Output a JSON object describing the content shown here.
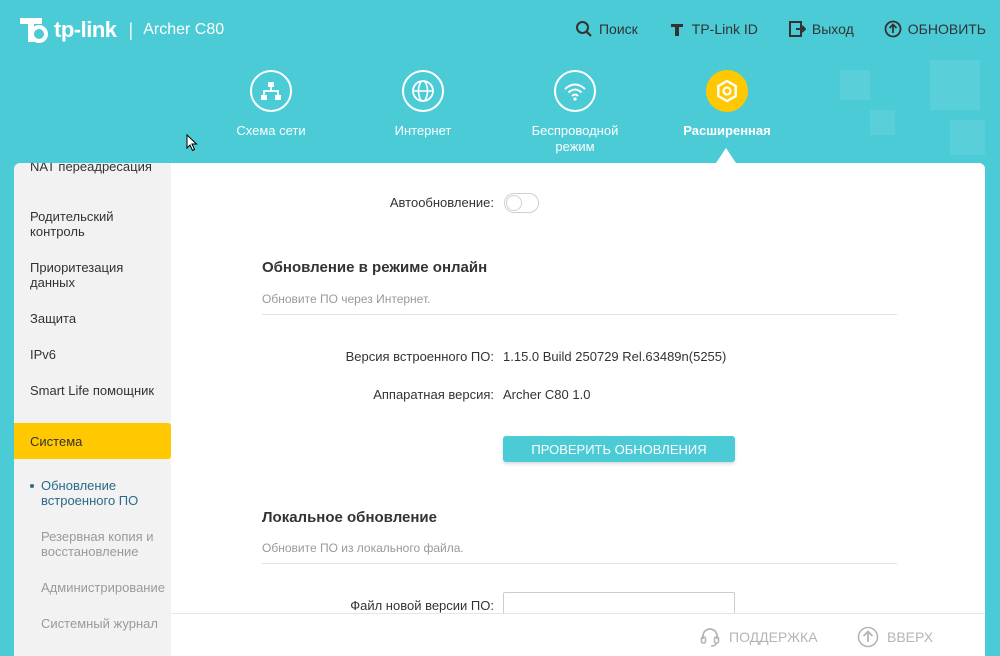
{
  "header": {
    "brand": "tp-link",
    "model": "Archer C80",
    "actions": [
      {
        "label": "Поиск",
        "icon": "search-icon"
      },
      {
        "label": "TP-Link ID",
        "icon": "tplink-id-icon"
      },
      {
        "label": "Выход",
        "icon": "logout-icon"
      },
      {
        "label": "ОБНОВИТЬ",
        "icon": "refresh-icon"
      }
    ]
  },
  "mainnav": [
    {
      "label": "Схема сети",
      "icon": "network-map-icon"
    },
    {
      "label": "Интернет",
      "icon": "globe-icon"
    },
    {
      "label": "Беспроводной режим",
      "icon": "wifi-icon"
    },
    {
      "label": "Расширенная",
      "icon": "gear-icon",
      "active": true
    }
  ],
  "sidebar": {
    "items": [
      {
        "label": "NAT переадресация"
      },
      {
        "label": "Родительский контроль"
      },
      {
        "label": "Приоритезация данных"
      },
      {
        "label": "Защита"
      },
      {
        "label": "IPv6"
      },
      {
        "label": "Smart Life помощник"
      },
      {
        "label": "Система"
      }
    ],
    "subitems": [
      {
        "label": "Обновление встроенного ПО"
      },
      {
        "label": "Резервная копия и восстановление"
      },
      {
        "label": "Администрирование"
      },
      {
        "label": "Системный журнал"
      }
    ]
  },
  "content": {
    "auto_update_label": "Автообновление:",
    "auto_update_on": false,
    "online": {
      "title": "Обновление в режиме онлайн",
      "desc": "Обновите ПО через Интернет.",
      "fw_label": "Версия встроенного ПО:",
      "fw_value": "1.15.0 Build 250729 Rel.63489n(5255)",
      "hw_label": "Аппаратная версия:",
      "hw_value": "Archer C80 1.0",
      "check_button": "ПРОВЕРИТЬ ОБНОВЛЕНИЯ"
    },
    "local": {
      "title": "Локальное обновление",
      "desc": "Обновите ПО из локального файла.",
      "file_label": "Файл новой версии ПО:"
    }
  },
  "footer": {
    "support": "ПОДДЕРЖКА",
    "top": "ВВЕРХ"
  },
  "colors": {
    "brand_teal": "#4acbd6",
    "accent_yellow": "#ffc800"
  }
}
